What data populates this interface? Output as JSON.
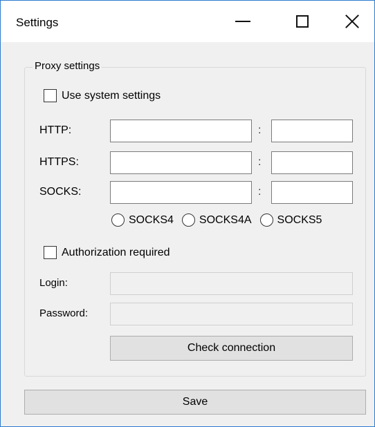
{
  "window": {
    "title": "Settings",
    "minimize_icon": "minimize-icon",
    "maximize_icon": "maximize-icon",
    "close_icon": "close-icon"
  },
  "proxy": {
    "group_label": "Proxy settings",
    "use_system_label": "Use system settings",
    "use_system_checked": false,
    "http": {
      "label": "HTTP:",
      "host": "",
      "port": ""
    },
    "https": {
      "label": "HTTPS:",
      "host": "",
      "port": ""
    },
    "socks": {
      "label": "SOCKS:",
      "host": "",
      "port": ""
    },
    "colon": ":",
    "socks_versions": [
      "SOCKS4",
      "SOCKS4A",
      "SOCKS5"
    ],
    "auth_label": "Authorization required",
    "auth_checked": false,
    "login_label": "Login:",
    "login_value": "",
    "password_label": "Password:",
    "password_value": "",
    "check_button": "Check connection"
  },
  "save_button": "Save"
}
